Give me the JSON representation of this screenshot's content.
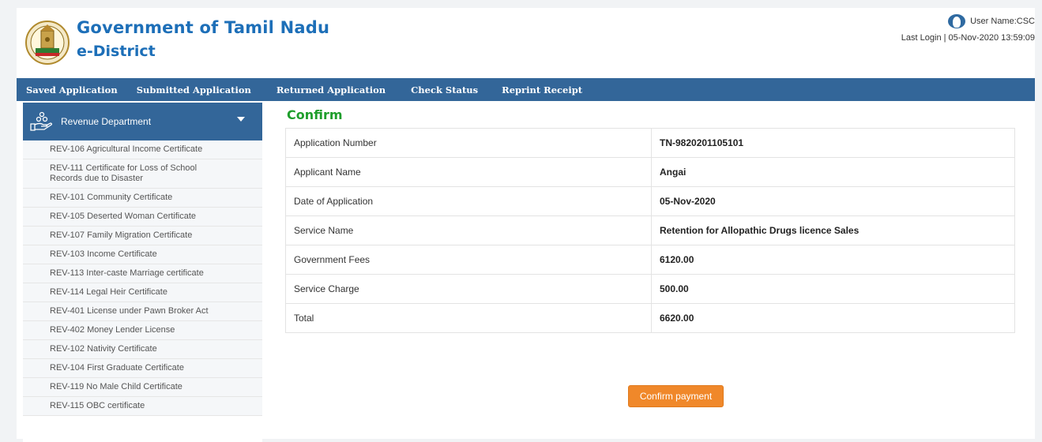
{
  "header": {
    "title": "Government of Tamil Nadu",
    "subtitle": "e-District",
    "user_label": "User Name:CSC",
    "last_login": "Last Login | 05-Nov-2020 13:59:09"
  },
  "nav": {
    "items": [
      {
        "label": "Saved Application"
      },
      {
        "label": "Submitted Application"
      },
      {
        "label": "Returned Application"
      },
      {
        "label": "Check Status"
      },
      {
        "label": "Reprint Receipt"
      }
    ]
  },
  "sidebar": {
    "department": "Revenue Department",
    "items": [
      {
        "label": "REV-106 Agricultural Income Certificate"
      },
      {
        "label": "REV-111 Certificate for Loss of School Records due to Disaster"
      },
      {
        "label": "REV-101 Community Certificate"
      },
      {
        "label": "REV-105 Deserted Woman Certificate"
      },
      {
        "label": "REV-107 Family Migration Certificate"
      },
      {
        "label": "REV-103 Income Certificate"
      },
      {
        "label": "REV-113 Inter-caste Marriage certificate"
      },
      {
        "label": "REV-114 Legal Heir Certificate"
      },
      {
        "label": "REV-401 License under Pawn Broker Act"
      },
      {
        "label": "REV-402 Money Lender License"
      },
      {
        "label": "REV-102 Nativity Certificate"
      },
      {
        "label": "REV-104 First Graduate Certificate"
      },
      {
        "label": "REV-119 No Male Child Certificate"
      },
      {
        "label": "REV-115 OBC certificate"
      }
    ]
  },
  "main": {
    "title": "Confirm",
    "rows": [
      {
        "label": "Application Number",
        "value": "TN-9820201105101"
      },
      {
        "label": "Applicant Name",
        "value": "Angai"
      },
      {
        "label": "Date of Application",
        "value": "05-Nov-2020"
      },
      {
        "label": "Service Name",
        "value": "Retention for Allopathic Drugs licence Sales"
      },
      {
        "label": "Government Fees",
        "value": "6120.00"
      },
      {
        "label": "Service Charge",
        "value": "500.00"
      },
      {
        "label": "Total",
        "value": "6620.00"
      }
    ],
    "confirm_button": "Confirm payment"
  },
  "colors": {
    "brand": "#1d6fb8",
    "nav_bg": "#336699",
    "confirm_title": "#1f9e2c",
    "button": "#f0882a"
  },
  "icons": {
    "emblem": "tamil-nadu-emblem-icon",
    "avatar": "user-avatar-icon",
    "department": "hand-coins-icon",
    "caret": "caret-down-icon"
  }
}
